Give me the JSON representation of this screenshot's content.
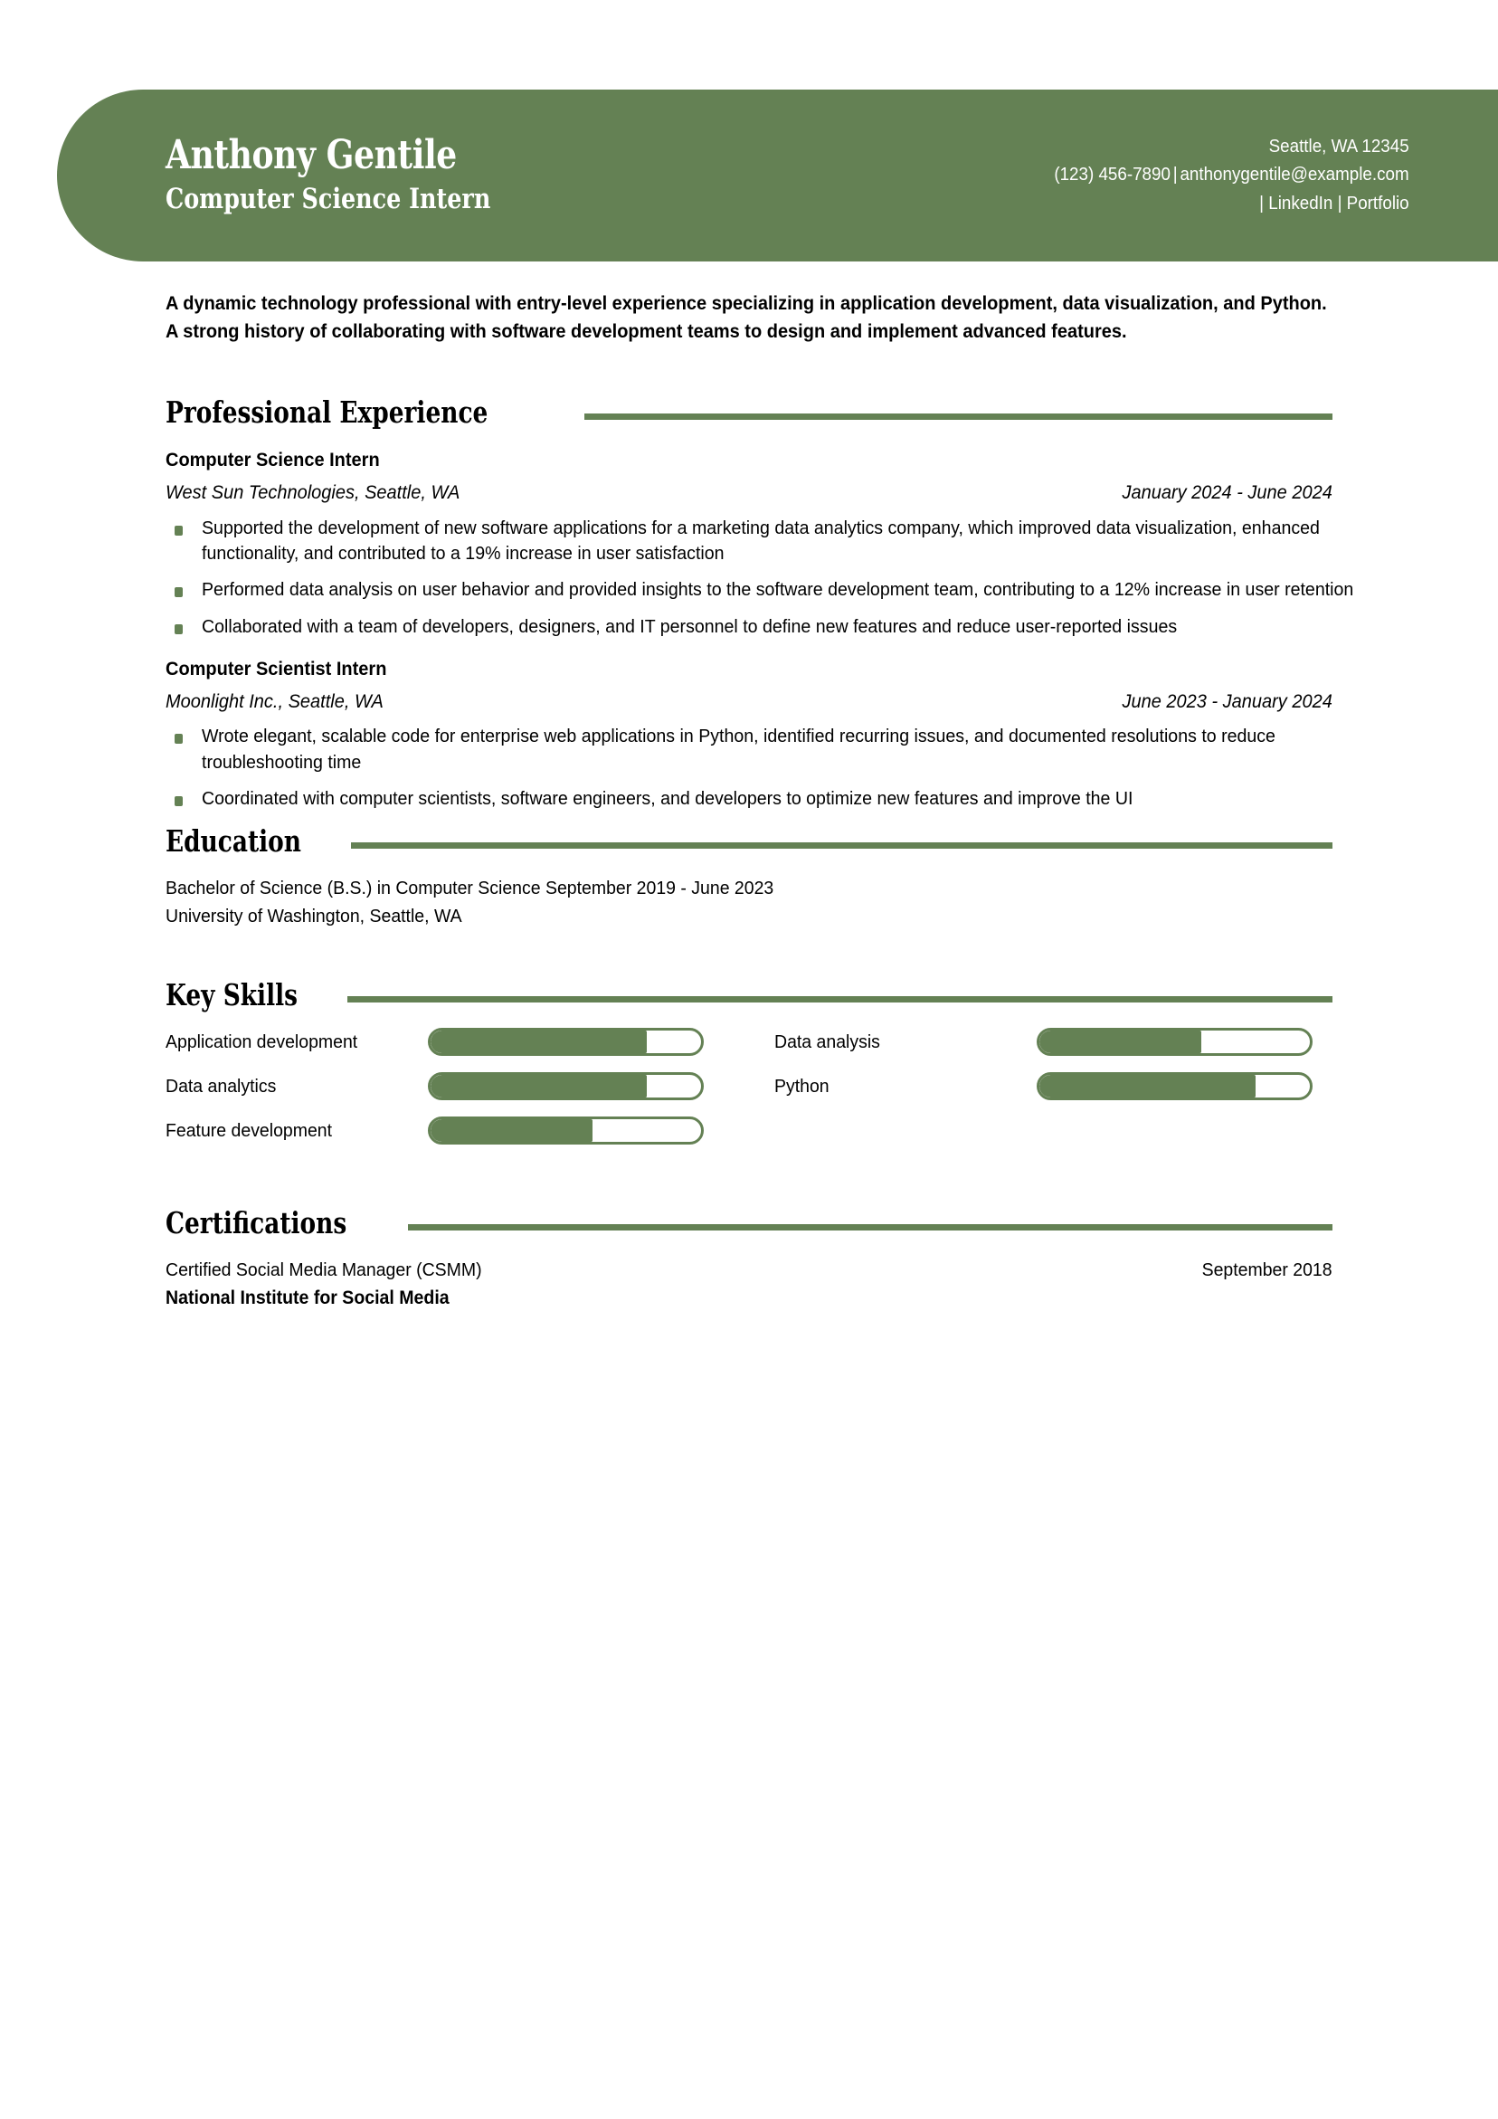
{
  "theme": {
    "accent": "#648154",
    "text": "#000000",
    "page_bg": "#ffffff",
    "header_text": "#ffffff"
  },
  "header": {
    "name": "Anthony Gentile",
    "job_title": "Computer Science Intern",
    "contact": {
      "location": "Seattle, WA 12345",
      "phone": "(123) 456-7890",
      "email": "anthonygentile@example.com",
      "separator": "|",
      "links": [
        {
          "label": "LinkedIn"
        },
        {
          "label": "Portfolio"
        }
      ],
      "line2_prefix": "",
      "line3": "| LinkedIn | Portfolio"
    }
  },
  "summary": {
    "text": "A dynamic technology professional with entry-level experience specializing in application development, data visualization, and Python. A strong history of collaborating with software development teams to design and implement advanced features."
  },
  "sections": {
    "experience": {
      "title": "Professional Experience",
      "jobs": [
        {
          "role": "Computer Science Intern",
          "company": "West Sun Technologies, Seattle, WA",
          "dates": "January 2024 - June 2024",
          "bullets": [
            "Supported the development of new software applications for a marketing data analytics company, which improved data visualization, enhanced functionality, and contributed to a 19% increase in user satisfaction",
            "Performed data analysis on user behavior and provided insights to the software development team, contributing to a 12% increase in user retention",
            "Collaborated with a team of developers, designers, and IT personnel to define new features and reduce user-reported issues"
          ]
        },
        {
          "role": "Computer Scientist Intern",
          "company": "Moonlight Inc., Seattle, WA",
          "dates": "June 2023 - January 2024",
          "bullets": [
            "Wrote elegant, scalable code for enterprise web applications in Python, identified recurring issues, and documented resolutions to reduce troubleshooting time",
            "Coordinated with computer scientists, software engineers, and developers to optimize new features and improve the UI"
          ]
        }
      ]
    },
    "education": {
      "title": "Education",
      "entries": [
        {
          "degree_and_dates": "Bachelor of Science (B.S.) in Computer Science  September 2019 - June 2023",
          "school": "University of Washington, Seattle, WA"
        }
      ]
    },
    "skills": {
      "title": "Key Skills",
      "left_column": [
        {
          "label": "Application development",
          "level": 80
        },
        {
          "label": "Data analytics",
          "level": 80
        },
        {
          "label": "Feature development",
          "level": 60
        }
      ],
      "right_column": [
        {
          "label": "Data analysis",
          "level": 60
        },
        {
          "label": "Python",
          "level": 80
        }
      ]
    },
    "certifications": {
      "title": "Certifications",
      "entries": [
        {
          "name": "Certified Social Media Manager (CSMM)",
          "date": "September 2018",
          "organization": "National Institute for Social Media"
        }
      ]
    }
  }
}
